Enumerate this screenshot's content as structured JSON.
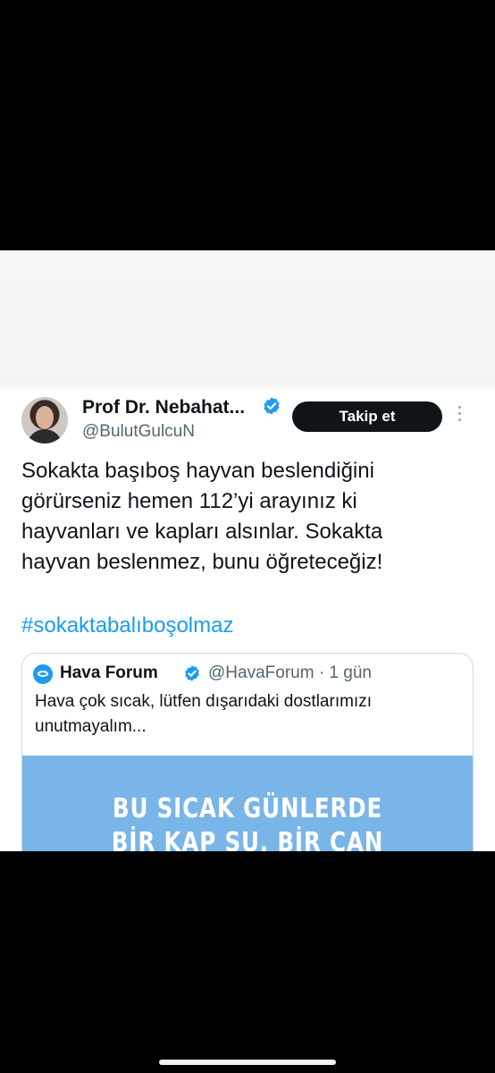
{
  "tweet": {
    "author_name": "Prof Dr. Nebahat...",
    "author_handle": "@BulutGulcuN",
    "follow_label": "Takip et",
    "text_lines": [
      "Sokakta başıboş hayvan beslendiğini",
      "görürseniz hemen 112’yi arayınız ki",
      "hayvanları ve kapları alsınlar. Sokakta",
      "hayvan beslenmez, bunu öğreteceğiz!"
    ],
    "hashtag": "#sokaktabalıboşolmaz"
  },
  "quote": {
    "author_name": "Hava Forum",
    "meta": "@HavaForum · 1 gün",
    "text_lines": [
      "Hava çok sıcak, lütfen dışarıdaki dostlarımızı",
      "unutmayalım..."
    ],
    "image_lines": [
      "BU SICAK GÜNLERDE",
      "BİR KAP SU, BİR CAN DEMEK..."
    ]
  },
  "icons": {
    "verified": "verified-badge-icon",
    "more": "more-options-icon",
    "quote_avatar": "hava-forum-logo-icon"
  },
  "colors": {
    "accent": "#1d9bf0",
    "text": "#0f1419",
    "secondary_text": "#536471",
    "follow_button": "#0f1419",
    "quote_image_bg": "#79b5e8"
  }
}
